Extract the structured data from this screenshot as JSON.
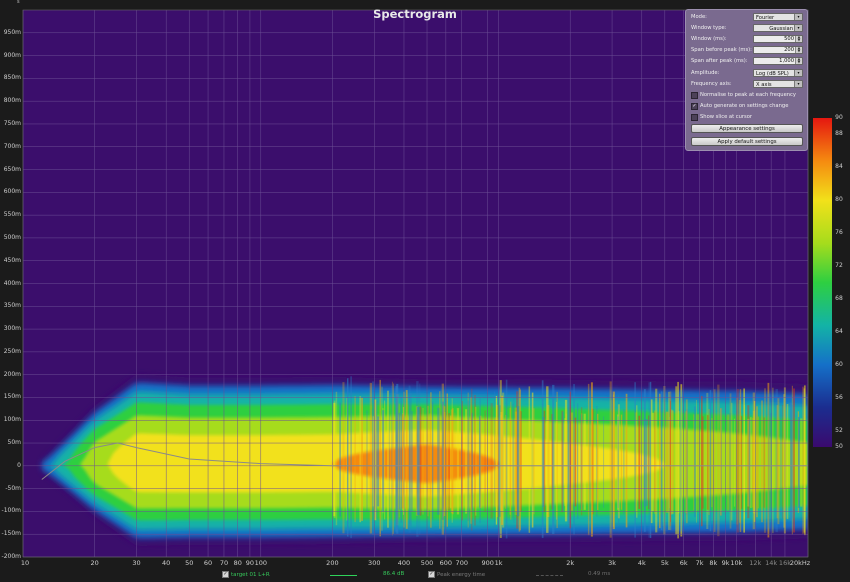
{
  "title": "Spectrogram",
  "y_top_marker": "s",
  "colorbar": {
    "ticks": [
      "90",
      "88",
      "84",
      "80",
      "76",
      "72",
      "68",
      "64",
      "60",
      "56",
      "52",
      "50"
    ],
    "min": 50,
    "max": 90
  },
  "settings_panel": {
    "mode_label": "Mode:",
    "mode_value": "Fourier",
    "window_type_label": "Window type:",
    "window_type_value": "Gaussian",
    "window_ms_label": "Window (ms):",
    "window_ms_value": "500",
    "span_before_label": "Span before peak (ms):",
    "span_before_value": "200",
    "span_after_label": "Span after peak (ms):",
    "span_after_value": "1,000",
    "amplitude_label": "Amplitude:",
    "amplitude_value": "Log (dB SPL)",
    "frequency_axis_label": "Frequency axis:",
    "frequency_axis_value": "X axis",
    "normalise_label": "Normalise to peak at each frequency",
    "normalise_checked": false,
    "auto_generate_label": "Auto generate on settings change",
    "auto_generate_checked": true,
    "show_slice_label": "Show slice at cursor",
    "show_slice_checked": false,
    "appearance_button": "Appearance settings",
    "defaults_button": "Apply default settings"
  },
  "legend": {
    "measurement_label": "target 01 L+R",
    "measurement_checked": true,
    "measurement_color": "#2fd35a",
    "measurement_value": "86.4 dB",
    "peak_energy_label": "Peak energy time",
    "peak_energy_checked": true,
    "peak_energy_value": "0.49 ms"
  },
  "chart_data": {
    "type": "heatmap",
    "title": "Spectrogram",
    "xlabel": "",
    "ylabel": "",
    "x_scale": "log",
    "xlim": [
      10,
      20000
    ],
    "ylim": [
      -200,
      1000
    ],
    "x_ticks": [
      "10",
      "20",
      "30",
      "40",
      "50",
      "60",
      "70",
      "80",
      "90",
      "100",
      "200",
      "300",
      "400",
      "500",
      "600",
      "700",
      "900",
      "1k",
      "2k",
      "3k",
      "4k",
      "5k",
      "6k",
      "7k",
      "8k",
      "9k",
      "10k",
      "12k",
      "14k",
      "16k",
      "20kHz"
    ],
    "y_ticks": [
      "950m",
      "900m",
      "850m",
      "800m",
      "750m",
      "700m",
      "650m",
      "600m",
      "550m",
      "500m",
      "450m",
      "400m",
      "350m",
      "300m",
      "250m",
      "200m",
      "150m",
      "100m",
      "50m",
      "0",
      "-50m",
      "-100m",
      "-150m",
      "-200m"
    ],
    "z_unit": "dB SPL",
    "z_range": [
      50,
      90
    ],
    "grid": true,
    "colorbar_position": "right",
    "energy_time_extent": {
      "frequency_hz": [
        12,
        20,
        30,
        50,
        100,
        200,
        500,
        1000,
        2000,
        5000,
        10000,
        20000
      ],
      "upper_edge_ms": [
        10,
        150,
        210,
        190,
        190,
        200,
        190,
        190,
        190,
        185,
        185,
        180
      ],
      "lower_edge_ms": [
        -20,
        -90,
        -160,
        -170,
        -170,
        -160,
        -160,
        -160,
        -160,
        -160,
        -160,
        -155
      ],
      "peak_level_db": [
        60,
        80,
        86,
        86,
        86,
        86,
        88,
        86,
        84,
        82,
        80,
        78
      ]
    },
    "peak_energy_time_curve": {
      "frequency_hz": [
        12,
        15,
        20,
        25,
        30,
        50,
        100,
        200,
        1000,
        20000
      ],
      "time_ms": [
        -30,
        10,
        40,
        50,
        40,
        15,
        5,
        0,
        0,
        0
      ]
    }
  }
}
